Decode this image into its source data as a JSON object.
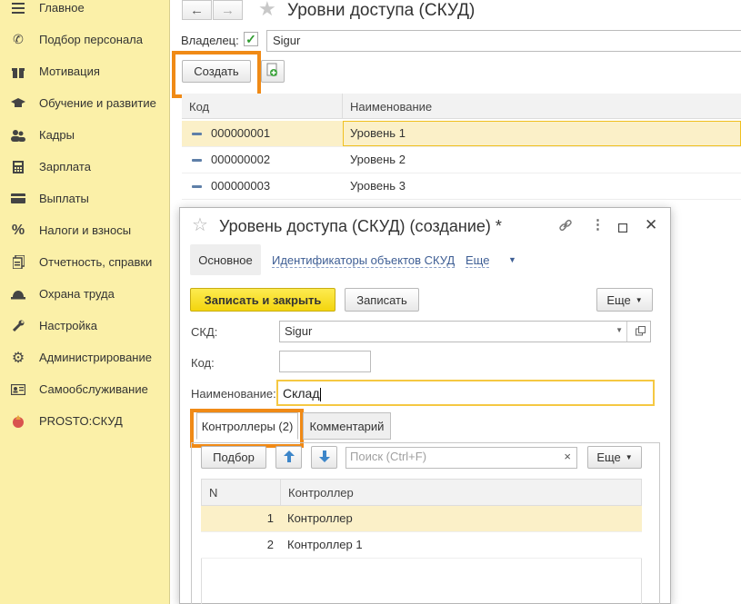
{
  "sidebar": {
    "items": [
      {
        "label": "Главное",
        "icon": "menu-icon"
      },
      {
        "label": "Подбор персонала",
        "icon": "phone-icon"
      },
      {
        "label": "Мотивация",
        "icon": "gift-icon"
      },
      {
        "label": "Обучение и развитие",
        "icon": "graduation-cap-icon"
      },
      {
        "label": "Кадры",
        "icon": "people-icon"
      },
      {
        "label": "Зарплата",
        "icon": "calculator-icon"
      },
      {
        "label": "Выплаты",
        "icon": "card-icon"
      },
      {
        "label": "Налоги и взносы",
        "icon": "percent-icon"
      },
      {
        "label": "Отчетность, справки",
        "icon": "documents-icon"
      },
      {
        "label": "Охрана труда",
        "icon": "helmet-icon"
      },
      {
        "label": "Настройка",
        "icon": "wrench-icon"
      },
      {
        "label": "Администрирование",
        "icon": "gears-icon"
      },
      {
        "label": "Самообслуживание",
        "icon": "id-card-icon"
      },
      {
        "label": "PROSTO:СКУД",
        "icon": "prosto-icon"
      }
    ]
  },
  "list_form": {
    "title": "Уровни доступа (СКУД)",
    "owner_label": "Владелец:",
    "owner_value": "Sigur",
    "owner_checked": true,
    "create_button": "Создать",
    "columns": [
      "Код",
      "Наименование"
    ],
    "rows": [
      {
        "code": "000000001",
        "name": "Уровень 1",
        "selected": true
      },
      {
        "code": "000000002",
        "name": "Уровень 2",
        "selected": false
      },
      {
        "code": "000000003",
        "name": "Уровень 3",
        "selected": false
      }
    ]
  },
  "dialog": {
    "title": "Уровень доступа (СКУД) (создание) *",
    "tabs": {
      "basic": "Основное",
      "identifiers": "Идентификаторы объектов СКУД",
      "more": "Еще"
    },
    "buttons": {
      "save_close": "Записать и закрыть",
      "save": "Записать",
      "more": "Еще"
    },
    "fields": {
      "skd_label": "СКД:",
      "skd_value": "Sigur",
      "code_label": "Код:",
      "code_value": "",
      "name_label": "Наименование:",
      "name_value": "Склад"
    },
    "subtabs": {
      "controllers": "Контроллеры (2)",
      "comment": "Комментарий"
    },
    "controllers_toolbar": {
      "pick": "Подбор",
      "search_placeholder": "Поиск (Ctrl+F)",
      "more": "Еще"
    },
    "controllers_table": {
      "columns": [
        "N",
        "Контроллер"
      ],
      "rows": [
        {
          "n": "1",
          "name": "Контроллер",
          "selected": true
        },
        {
          "n": "2",
          "name": "Контроллер 1",
          "selected": false
        }
      ]
    }
  },
  "colors": {
    "sidebar_bg": "#fbf0a8",
    "highlight_frame": "#f08a16",
    "primary_button": "#f3d50e",
    "selected_row": "#fbf0c8"
  }
}
